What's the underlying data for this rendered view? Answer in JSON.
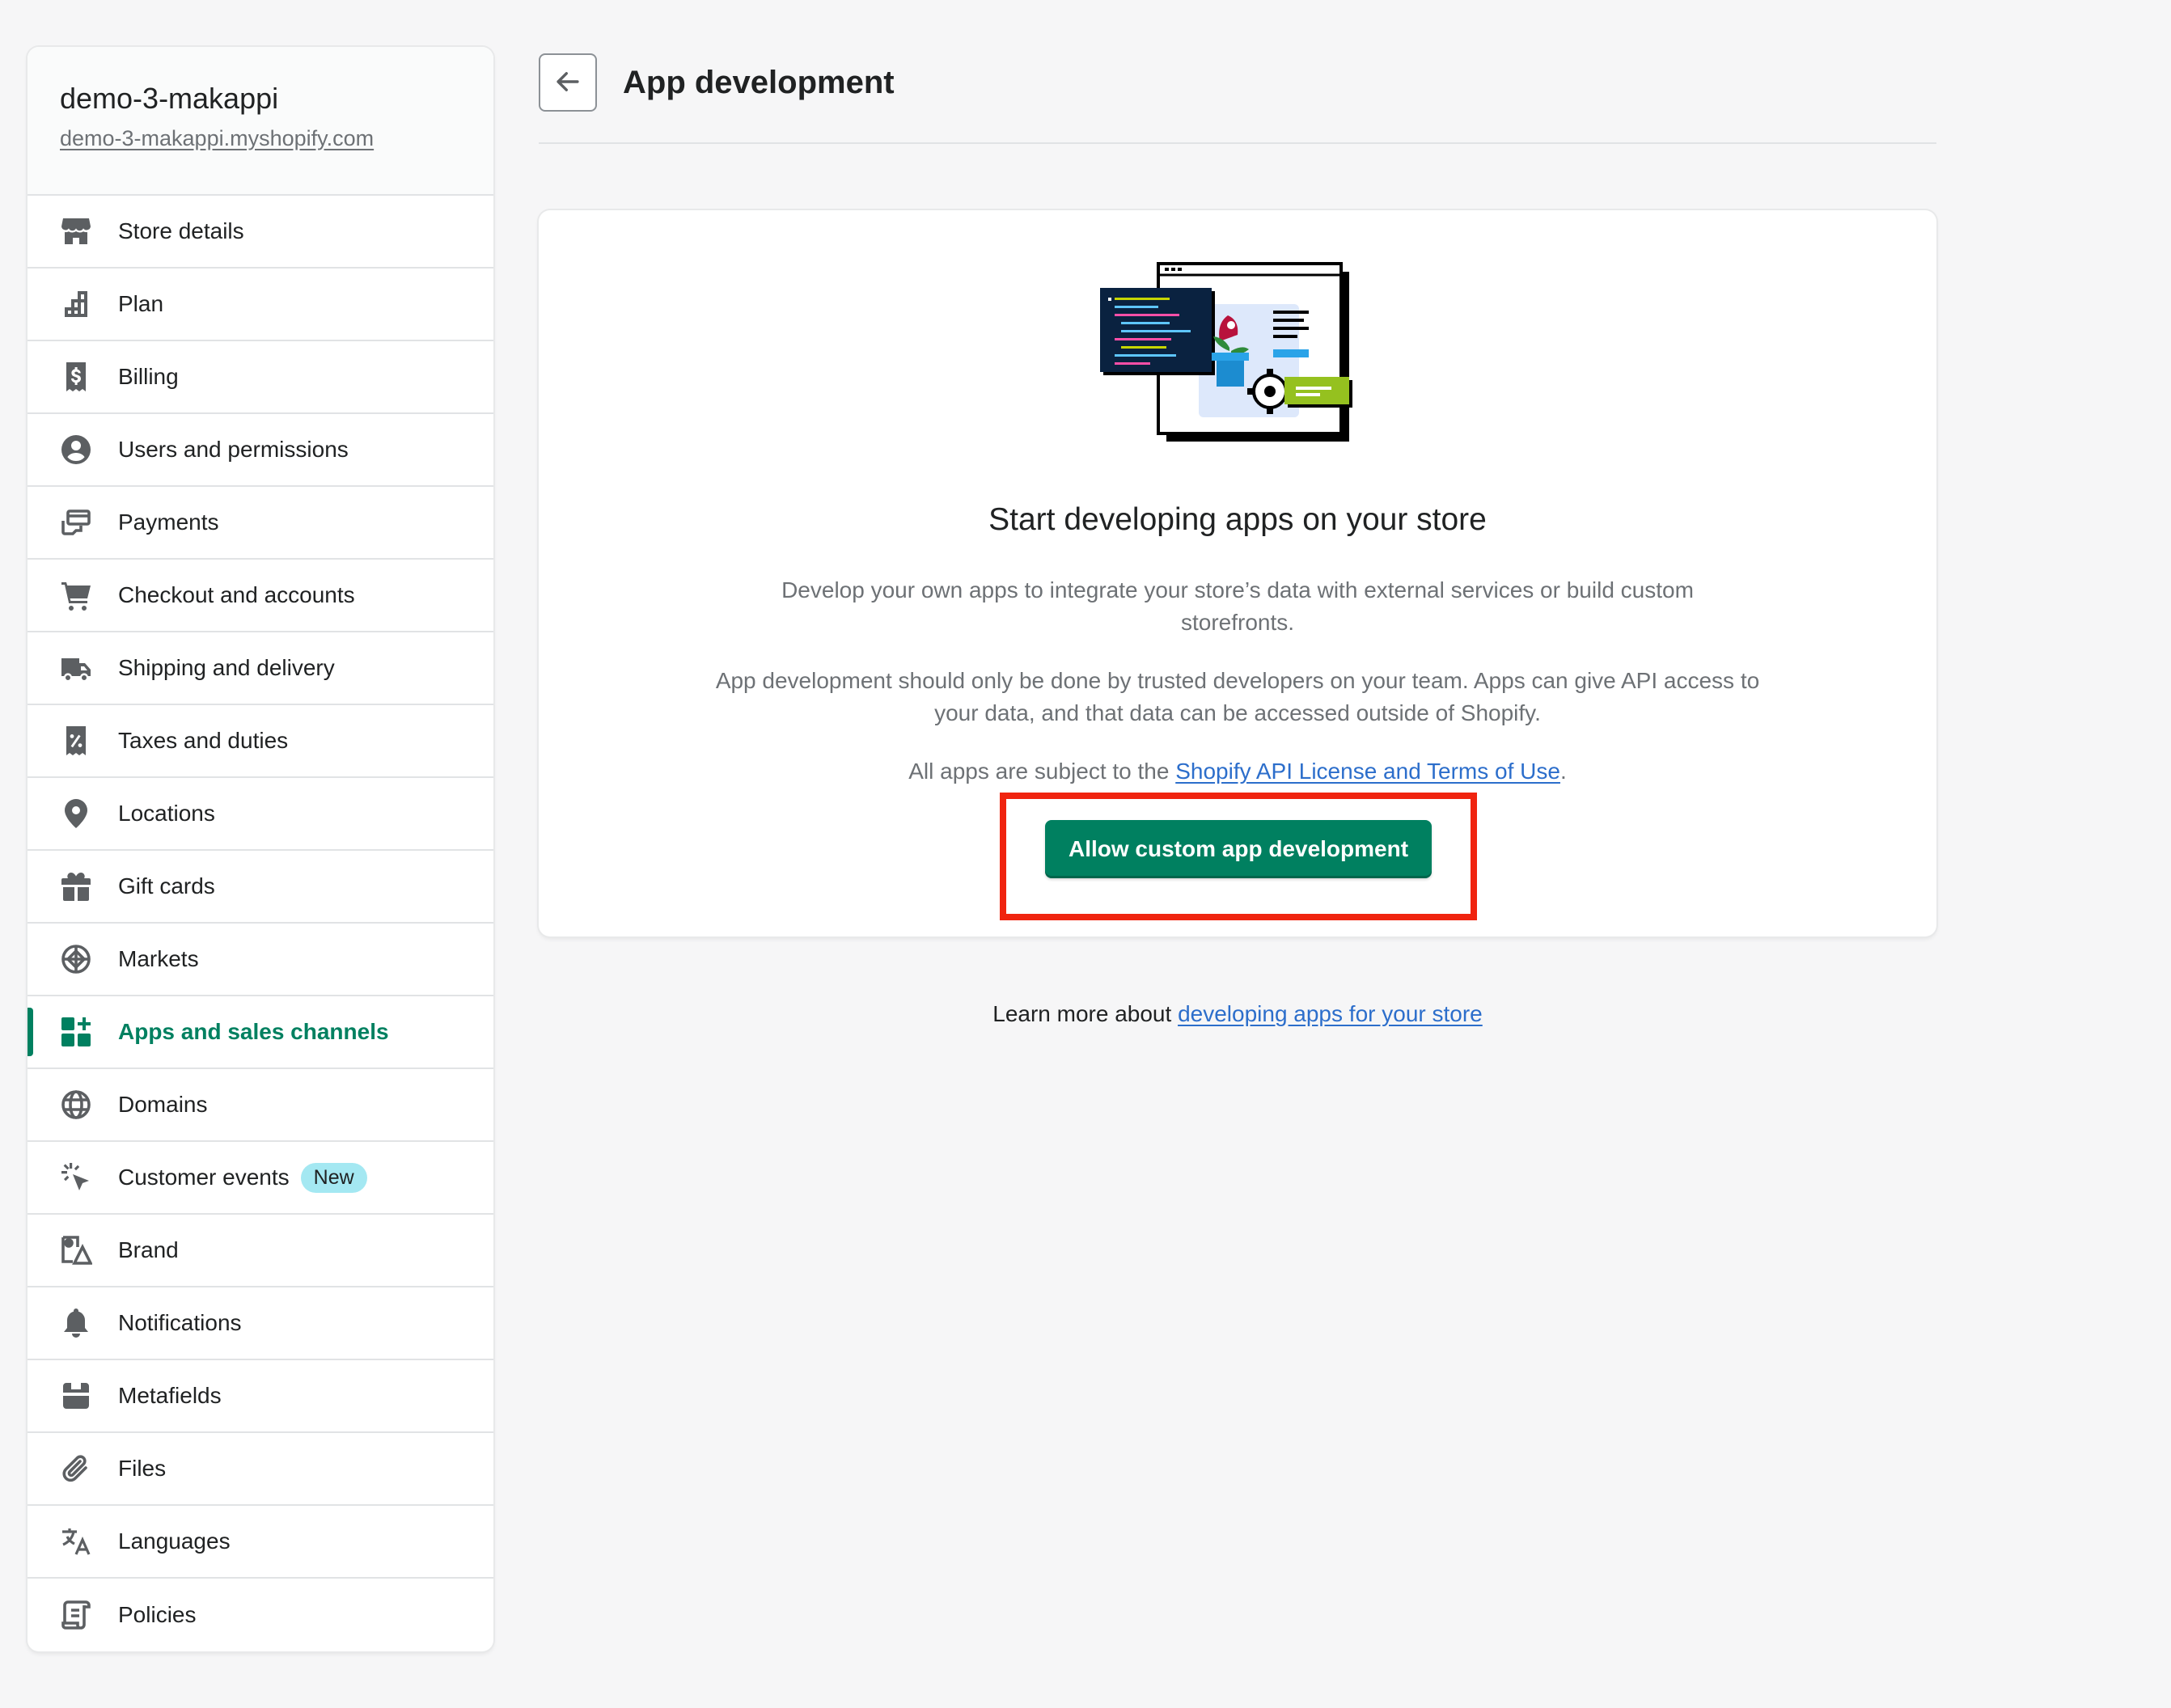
{
  "store": {
    "name": "demo-3-makappi",
    "url": "demo-3-makappi.myshopify.com"
  },
  "sidebar": {
    "items": [
      {
        "label": "Store details",
        "icon": "store-icon"
      },
      {
        "label": "Plan",
        "icon": "plan-icon"
      },
      {
        "label": "Billing",
        "icon": "billing-icon"
      },
      {
        "label": "Users and permissions",
        "icon": "user-icon"
      },
      {
        "label": "Payments",
        "icon": "payments-icon"
      },
      {
        "label": "Checkout and accounts",
        "icon": "cart-icon"
      },
      {
        "label": "Shipping and delivery",
        "icon": "truck-icon"
      },
      {
        "label": "Taxes and duties",
        "icon": "tax-icon"
      },
      {
        "label": "Locations",
        "icon": "location-pin-icon"
      },
      {
        "label": "Gift cards",
        "icon": "gift-icon"
      },
      {
        "label": "Markets",
        "icon": "markets-icon"
      },
      {
        "label": "Apps and sales channels",
        "icon": "apps-icon",
        "active": true
      },
      {
        "label": "Domains",
        "icon": "globe-icon"
      },
      {
        "label": "Customer events",
        "icon": "cursor-click-icon",
        "badge": "New"
      },
      {
        "label": "Brand",
        "icon": "brand-icon"
      },
      {
        "label": "Notifications",
        "icon": "bell-icon"
      },
      {
        "label": "Metafields",
        "icon": "metafields-icon"
      },
      {
        "label": "Files",
        "icon": "paperclip-icon"
      },
      {
        "label": "Languages",
        "icon": "translate-icon"
      },
      {
        "label": "Policies",
        "icon": "policy-icon"
      }
    ]
  },
  "header": {
    "title": "App development",
    "back_icon": "arrow-left-icon"
  },
  "card": {
    "heading": "Start developing apps on your store",
    "paragraph1": "Develop your own apps to integrate your store’s data with external services or build custom storefronts.",
    "paragraph2": "App development should only be done by trusted developers on your team. Apps can give API access to your data, and that data can be accessed outside of Shopify.",
    "paragraph3_prefix": "All apps are subject to the ",
    "paragraph3_link": "Shopify API License and Terms of Use",
    "paragraph3_suffix": ".",
    "button_label": "Allow custom app development"
  },
  "footer": {
    "prefix": "Learn more about ",
    "link": "developing apps for your store"
  },
  "colors": {
    "accent": "#008060",
    "link": "#2c6ecb",
    "highlight": "#f0240f",
    "badge": "#a4e8f2"
  }
}
